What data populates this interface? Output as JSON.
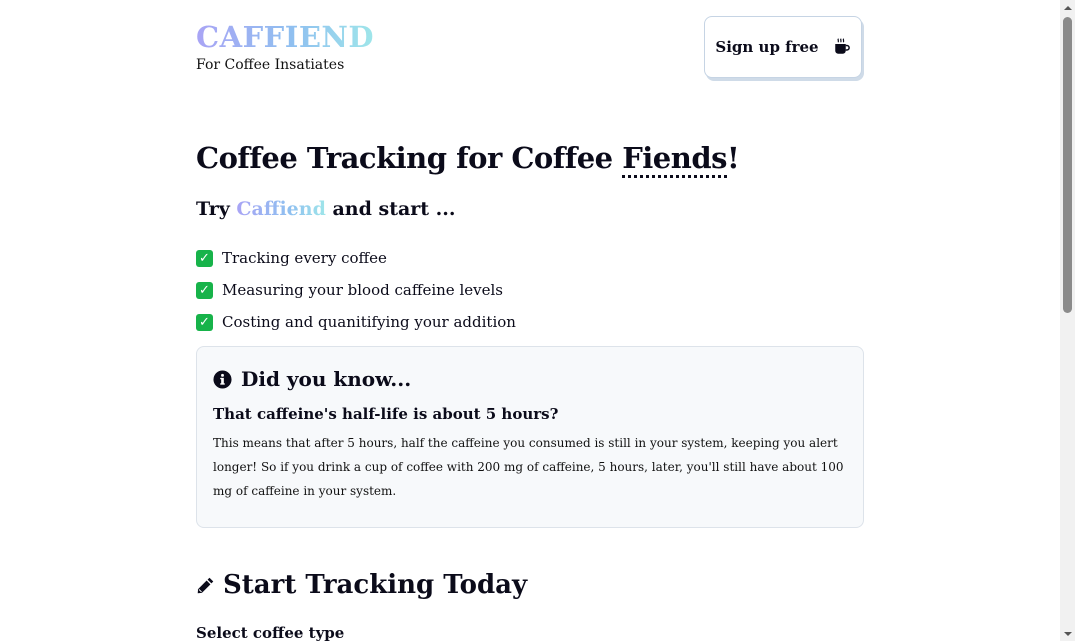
{
  "header": {
    "logo": "CAFFIEND",
    "tagline": "For Coffee Insatiates",
    "signup_label": "Sign up free",
    "signup_icon": "mug-hot-icon"
  },
  "hero": {
    "title_prefix": "Coffee Tracking for Coffee ",
    "title_highlight": "Fiends",
    "title_suffix": "!",
    "try_prefix": "Try ",
    "try_brand": "Caffiend",
    "try_suffix": " and start ..."
  },
  "features": [
    {
      "label": "Tracking every coffee"
    },
    {
      "label": "Measuring your blood caffeine levels"
    },
    {
      "label": "Costing and quanitifying your addition"
    }
  ],
  "did_you_know": {
    "title": "Did you know...",
    "subtitle": "That caffeine's half-life is about 5 hours?",
    "body": "This means that after 5 hours, half the caffeine you consumed is still in your system, keeping you alert longer! So if you drink a cup of coffee with 200 mg of caffeine, 5 hours, later, you'll still have about 100 mg of caffeine in your system."
  },
  "tracking": {
    "title": "Start Tracking Today",
    "select_label": "Select coffee type"
  },
  "colors": {
    "brand_gradient_start": "#a9a4f5",
    "brand_gradient_end": "#9fe6ea",
    "check_green": "#17b34a",
    "card_background": "#f7f9fb"
  }
}
